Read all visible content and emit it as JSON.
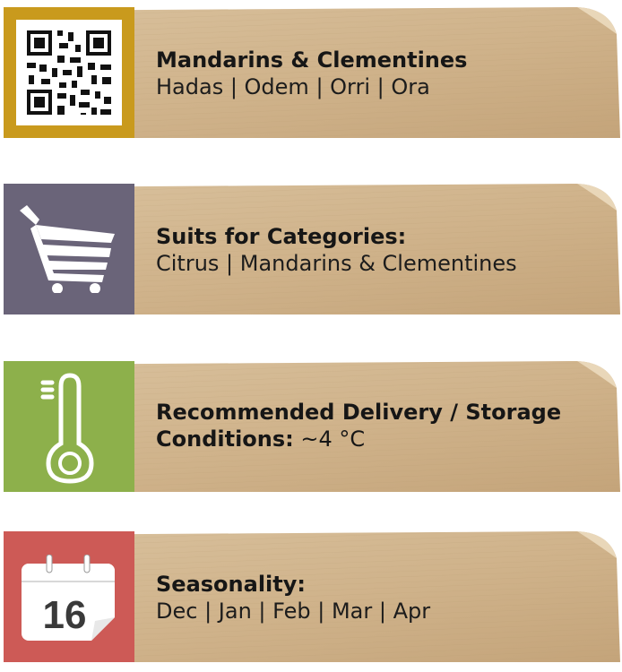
{
  "cards": [
    {
      "heading": "Mandarins & Clementines",
      "value": "Hadas | Odem | Orri | Ora",
      "icon": "qr-code-icon",
      "color": "#c99a1d"
    },
    {
      "heading": "Suits for Categories:",
      "value": "Citrus | Mandarins & Clementines",
      "icon": "shopping-cart-icon",
      "color": "#6a6479"
    },
    {
      "heading_line1": "Recommended Delivery / Storage",
      "heading_line2": "Conditions:",
      "value": "~4 °C",
      "icon": "thermometer-icon",
      "color": "#8db04b"
    },
    {
      "heading": "Seasonality:",
      "value": "Dec | Jan | Feb | Mar | Apr",
      "icon": "calendar-icon",
      "calendar_day": "16",
      "color": "#cd5a56"
    }
  ]
}
